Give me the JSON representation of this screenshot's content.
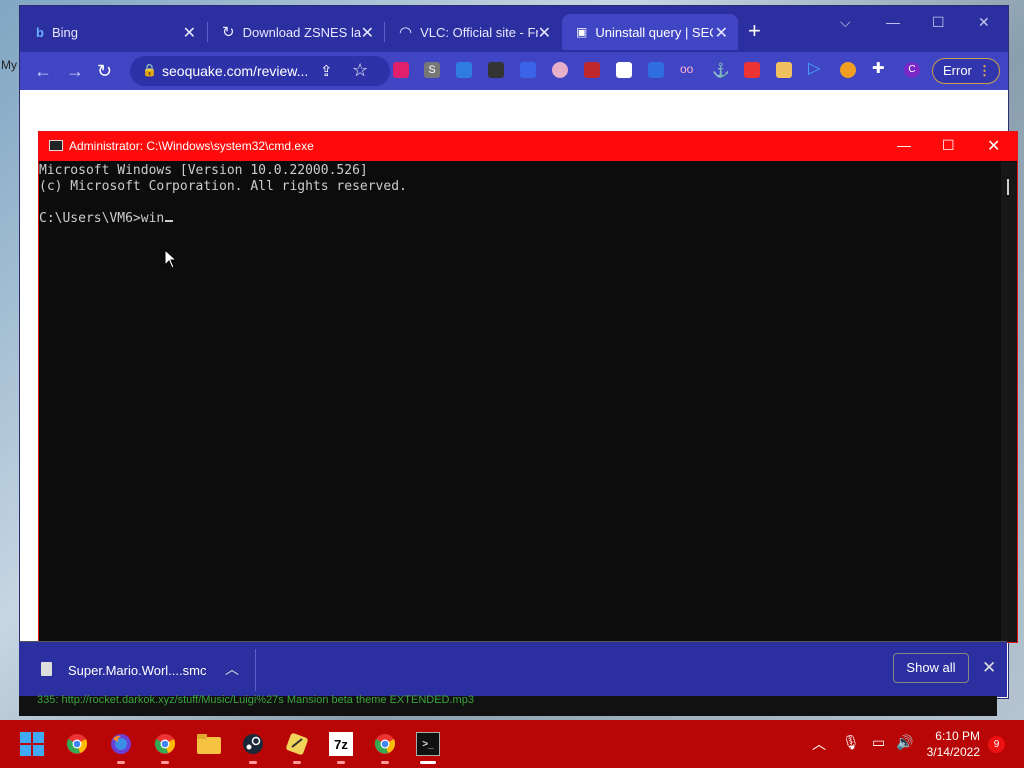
{
  "desktop": {
    "label": "My"
  },
  "browser": {
    "tabs": [
      {
        "title": "Bing",
        "icon": "bing-icon"
      },
      {
        "title": "Download ZSNES late",
        "icon": "loading-icon"
      },
      {
        "title": "VLC: Official site - Fre",
        "icon": "loading-icon"
      },
      {
        "title": "Uninstall query | SEOq",
        "icon": "seoquake-icon",
        "active": true
      }
    ],
    "new_tab": "+",
    "url": "seoquake.com/review...",
    "error_label": "Error",
    "error_dots": "⋮"
  },
  "cmd": {
    "title": "Administrator: C:\\Windows\\system32\\cmd.exe",
    "lines": [
      "Microsoft Windows [Version 10.0.22000.526]",
      "(c) Microsoft Corporation. All rights reserved.",
      "",
      "C:\\Users\\VM6>win"
    ]
  },
  "download_shelf": {
    "file_name": "Super.Mario.Worl....smc",
    "show_all": "Show all"
  },
  "background_text": "335: http://rocket.darkok.xyz/stuff/Music/Luigi%27s Mansion beta theme EXTENDED.mp3",
  "taskbar": {
    "time": "6:10 PM",
    "date": "3/14/2022",
    "notifications": "9",
    "apps": [
      "start",
      "chrome",
      "firefox",
      "chrome",
      "file-explorer",
      "steam",
      "app",
      "7zip",
      "chrome",
      "terminal"
    ],
    "sevenzip_label": "7z"
  },
  "colors": {
    "browser_frame": "#2b2fa0",
    "browser_toolbar": "#4045c4",
    "cmd_titlebar": "#ff0a0a",
    "taskbar": "#b80606"
  }
}
